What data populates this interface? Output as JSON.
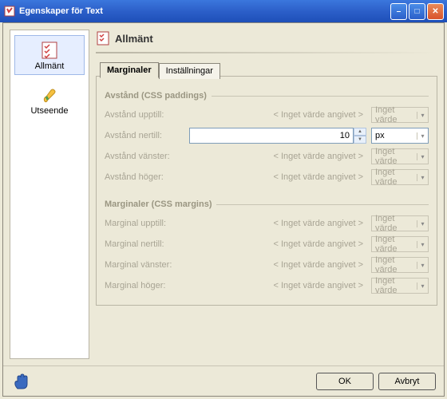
{
  "window": {
    "title": "Egenskaper för Text"
  },
  "sidebar": {
    "items": [
      {
        "label": "Allmänt"
      },
      {
        "label": "Utseende"
      }
    ]
  },
  "header": {
    "title": "Allmänt"
  },
  "tabs": [
    {
      "label": "Marginaler"
    },
    {
      "label": "Inställningar"
    }
  ],
  "groups": {
    "padding": {
      "title": "Avstånd (CSS paddings)",
      "rows": [
        {
          "label": "Avstånd upptill:",
          "placeholder": "< Inget värde angivet >",
          "unit": "Inget värde"
        },
        {
          "label": "Avstånd nertill:",
          "value": "10",
          "unit": "px"
        },
        {
          "label": "Avstånd vänster:",
          "placeholder": "< Inget värde angivet >",
          "unit": "Inget värde"
        },
        {
          "label": "Avstånd höger:",
          "placeholder": "< Inget värde angivet >",
          "unit": "Inget värde"
        }
      ]
    },
    "margin": {
      "title": "Marginaler (CSS margins)",
      "rows": [
        {
          "label": "Marginal upptill:",
          "placeholder": "< Inget värde angivet >",
          "unit": "Inget värde"
        },
        {
          "label": "Marginal nertill:",
          "placeholder": "< Inget värde angivet >",
          "unit": "Inget värde"
        },
        {
          "label": "Marginal vänster:",
          "placeholder": "< Inget värde angivet >",
          "unit": "Inget värde"
        },
        {
          "label": "Marginal höger:",
          "placeholder": "< Inget värde angivet >",
          "unit": "Inget värde"
        }
      ]
    }
  },
  "buttons": {
    "ok": "OK",
    "cancel": "Avbryt"
  }
}
